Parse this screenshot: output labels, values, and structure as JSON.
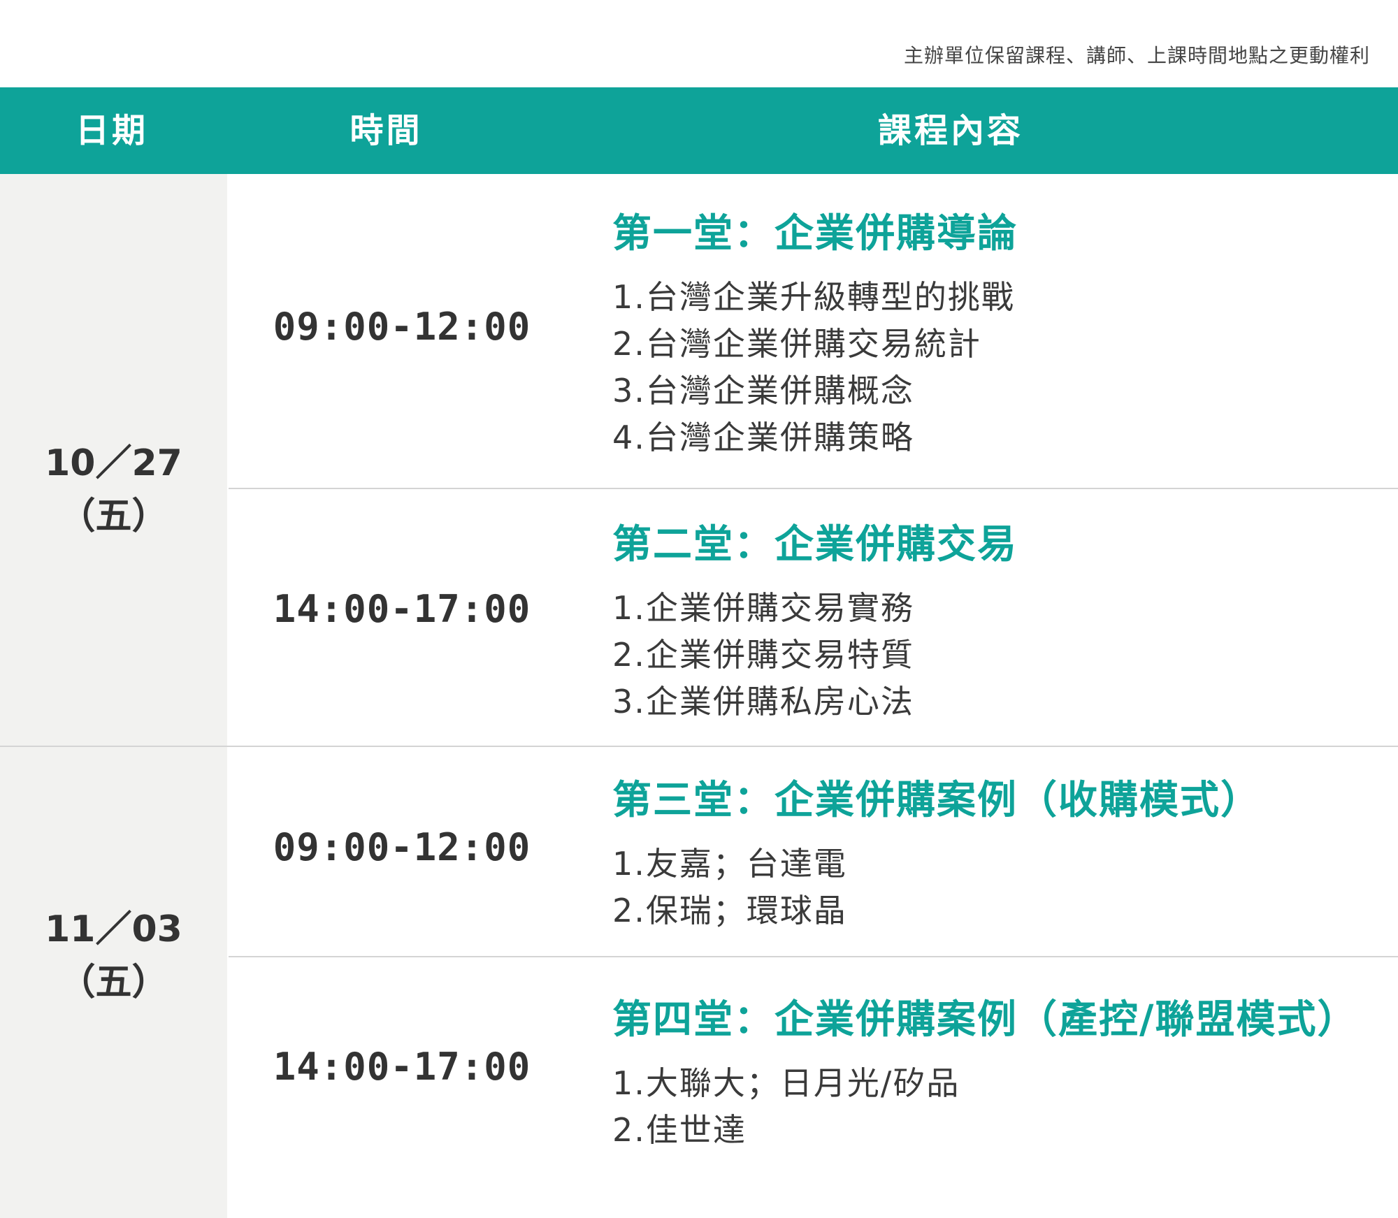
{
  "notice": "主辦單位保留課程、講師、上課時間地點之更動權利",
  "header": {
    "date": "日期",
    "time": "時間",
    "content": "課程內容"
  },
  "days": [
    {
      "date": "10／27",
      "weekday": "（五）",
      "sessions": [
        {
          "time": "09:00-12:00",
          "title": "第一堂：企業併購導論",
          "items": [
            "1.台灣企業升級轉型的挑戰",
            "2.台灣企業併購交易統計",
            "3.台灣企業併購概念",
            "4.台灣企業併購策略"
          ]
        },
        {
          "time": "14:00-17:00",
          "title": "第二堂：企業併購交易",
          "items": [
            "1.企業併購交易實務",
            "2.企業併購交易特質",
            "3.企業併購私房心法"
          ]
        }
      ]
    },
    {
      "date": "11／03",
      "weekday": "（五）",
      "sessions": [
        {
          "time": "09:00-12:00",
          "title": "第三堂：企業併購案例（收購模式）",
          "items": [
            "1.友嘉；台達電",
            "2.保瑞；環球晶"
          ]
        },
        {
          "time": "14:00-17:00",
          "title": "第四堂：企業併購案例（產控/聯盟模式）",
          "items": [
            "1.大聯大；日月光/矽品",
            "2.佳世達"
          ]
        }
      ]
    }
  ],
  "colors": {
    "accent": "#0ea399",
    "date_bg": "#f2f2f0",
    "text": "#333333"
  }
}
